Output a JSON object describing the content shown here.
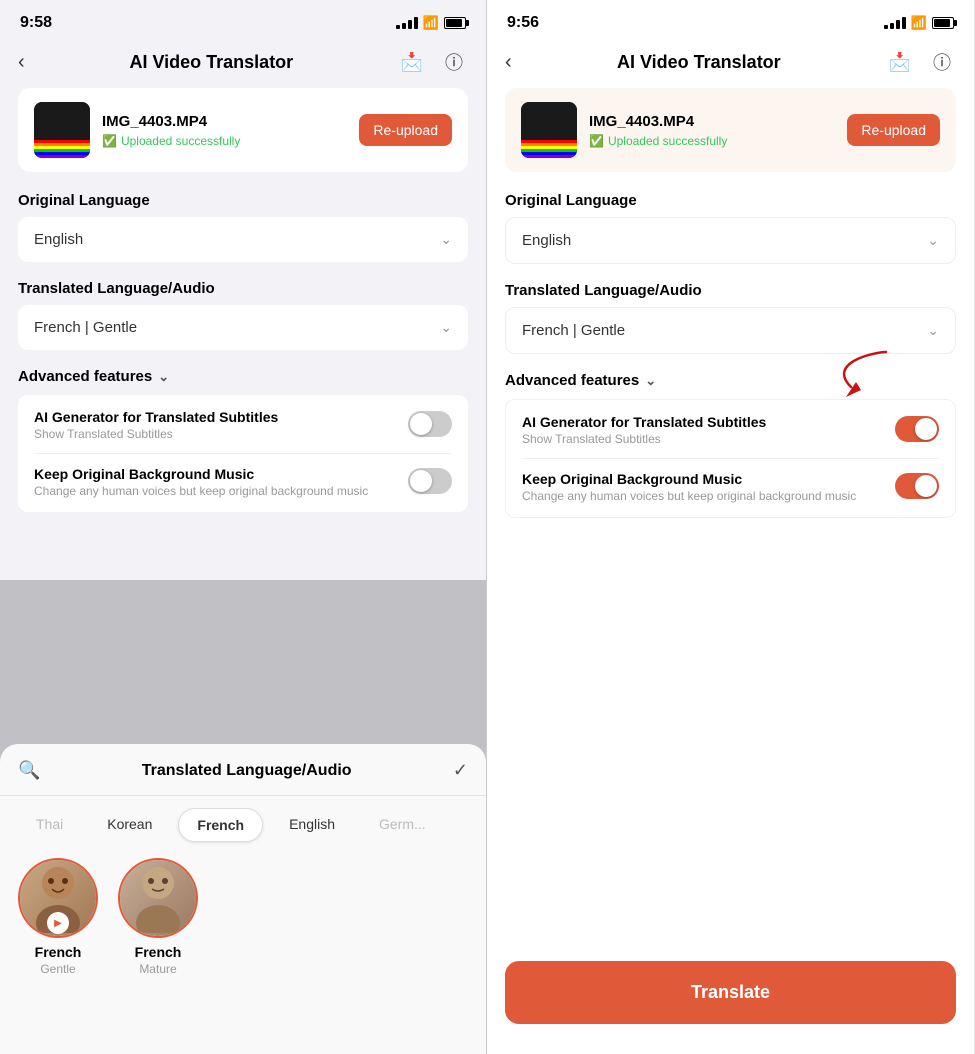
{
  "left_phone": {
    "status": {
      "time": "9:58",
      "signal": true,
      "wifi": true,
      "battery": true
    },
    "nav": {
      "title": "AI Video Translator",
      "back": "‹"
    },
    "file": {
      "name": "IMG_4403.MP4",
      "status": "Uploaded successfully",
      "reupload": "Re-upload"
    },
    "original_language_label": "Original Language",
    "original_language_value": "English",
    "translated_language_label": "Translated Language/Audio",
    "translated_language_value": "French | Gentle",
    "advanced_features_label": "Advanced features",
    "features": [
      {
        "title": "AI Generator for Translated Subtitles",
        "sub": "Show Translated Subtitles",
        "enabled": false
      },
      {
        "title": "Keep Original Background Music",
        "sub": "Change any human voices but keep original background music",
        "enabled": false
      }
    ],
    "bottom_sheet": {
      "title": "Translated Language/Audio",
      "lang_tabs": [
        "Thai",
        "Korean",
        "French",
        "English",
        "Germ..."
      ],
      "active_tab": "French",
      "voices": [
        {
          "name": "French",
          "style": "Gentle"
        },
        {
          "name": "French",
          "style": "Mature"
        }
      ]
    }
  },
  "right_phone": {
    "status": {
      "time": "9:56"
    },
    "nav": {
      "title": "AI Video Translator"
    },
    "file": {
      "name": "IMG_4403.MP4",
      "status": "Uploaded successfully",
      "reupload": "Re-upload"
    },
    "original_language_label": "Original Language",
    "original_language_value": "English",
    "translated_language_label": "Translated Language/Audio",
    "translated_language_value": "French | Gentle",
    "advanced_features_label": "Advanced features",
    "features": [
      {
        "title": "AI Generator for Translated Subtitles",
        "sub": "Show Translated Subtitles",
        "enabled": true
      },
      {
        "title": "Keep Original Background Music",
        "sub": "Change any human voices but keep original background music",
        "enabled": true
      }
    ],
    "translate_btn": "Translate"
  }
}
